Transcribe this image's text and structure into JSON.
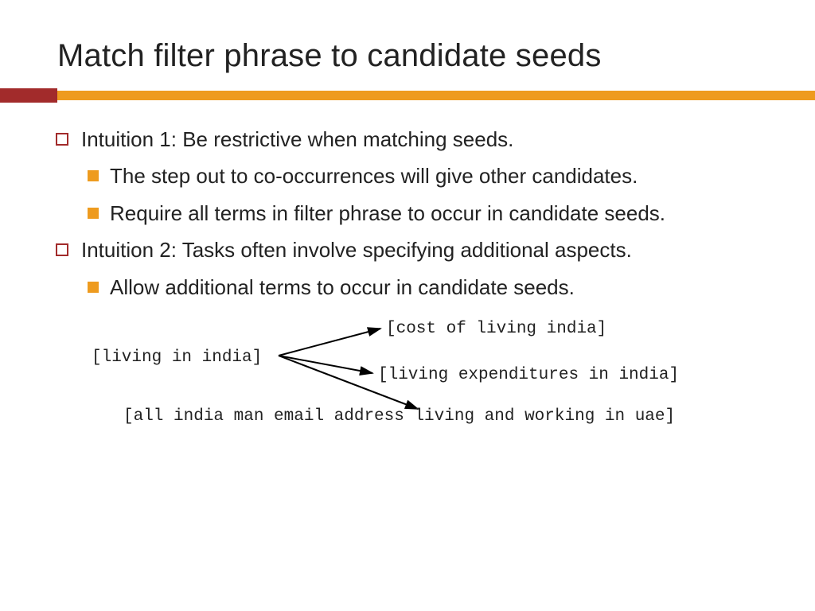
{
  "title": "Match filter phrase to candidate seeds",
  "bullets": {
    "i1": {
      "text": "Intuition 1: Be restrictive when matching seeds."
    },
    "i1a": {
      "text": "The step out to co-occurrences will give other candidates."
    },
    "i1b": {
      "text": "Require all terms in filter phrase to occur in candidate seeds."
    },
    "i2": {
      "text": "Intuition 2: Tasks often involve specifying additional aspects."
    },
    "i2a": {
      "text": "Allow additional terms to occur in candidate seeds."
    }
  },
  "diagram": {
    "source": "[living in india]",
    "target_a": "[cost of living india]",
    "target_b": "[living expenditures in india]",
    "target_c": "[all india man email address living and working in uae]"
  }
}
